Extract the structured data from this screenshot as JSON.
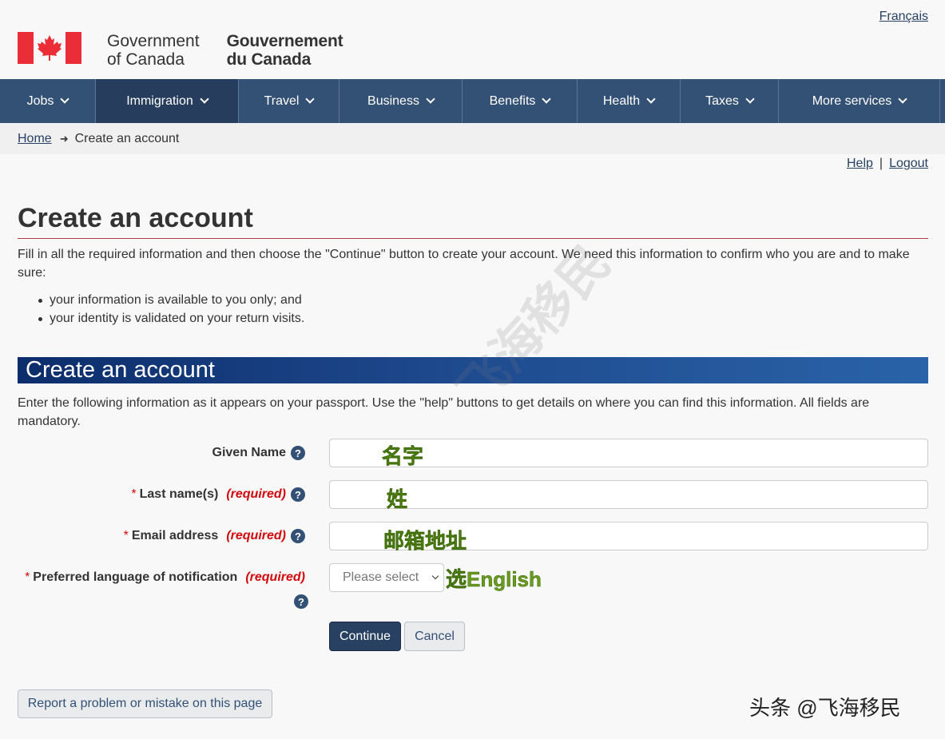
{
  "header": {
    "language_link": "Français",
    "brand_en_line1": "Government",
    "brand_en_line2": "of Canada",
    "brand_fr_line1": "Gouvernement",
    "brand_fr_line2": "du Canada"
  },
  "nav": {
    "items": [
      {
        "label": "Jobs"
      },
      {
        "label": "Immigration"
      },
      {
        "label": "Travel"
      },
      {
        "label": "Business"
      },
      {
        "label": "Benefits"
      },
      {
        "label": "Health"
      },
      {
        "label": "Taxes"
      },
      {
        "label": "More services"
      }
    ],
    "active": "Immigration"
  },
  "breadcrumb": {
    "home": "Home",
    "arrow": "➜",
    "current": "Create an account"
  },
  "utility": {
    "help": "Help",
    "separator": "|",
    "logout": "Logout"
  },
  "page": {
    "title": "Create an account",
    "intro": "Fill in all the required information and then choose the \"Continue\" button to create your account. We need this information to confirm who you are and to make sure:",
    "bullets": [
      "your information is available to you only; and",
      "your identity is validated on your return visits."
    ]
  },
  "panel": {
    "heading": "Create an account",
    "instructions": "Enter the following information as it appears on your passport. Use the \"help\" buttons to get details on where you can find this information. All fields are mandatory."
  },
  "form": {
    "required_marker": "*",
    "required_text": "(required)",
    "help_glyph": "?",
    "given_name": {
      "label": "Given Name",
      "value": "",
      "annotation": "名字"
    },
    "last_name": {
      "label": "Last name(s)",
      "value": "",
      "annotation": "姓"
    },
    "email": {
      "label": "Email address",
      "value": "",
      "annotation": "邮箱地址"
    },
    "language": {
      "label": "Preferred language of notification",
      "selected": "Please select",
      "annotation": "选English"
    },
    "continue": "Continue",
    "cancel": "Cancel"
  },
  "footer": {
    "report_button": "Report a problem or mistake on this page"
  },
  "watermark": {
    "corner_text": "头条 @飞海移民",
    "diagonal_text": "飞海移民"
  },
  "colors": {
    "nav_bg": "#335075",
    "primary_button": "#284162",
    "required_red": "#d3080c",
    "flag_red": "#eb2d37",
    "title_rule": "#af3c43"
  }
}
